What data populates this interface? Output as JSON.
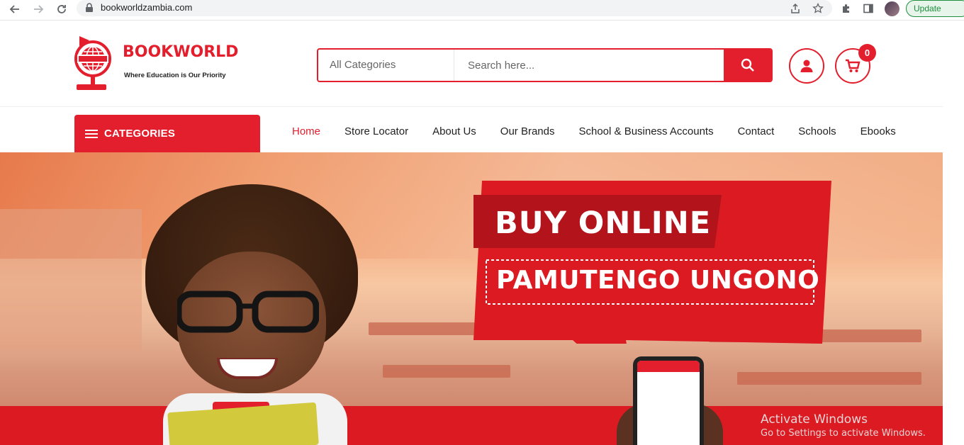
{
  "browser": {
    "url": "bookworldzambia.com",
    "update_label": "Update"
  },
  "header": {
    "brand_name": "BOOKWORLD",
    "tagline": "Where Education is Our Priority",
    "search": {
      "category": "All Categories",
      "placeholder": "Search here..."
    },
    "cart_count": "0"
  },
  "nav": {
    "categories_label": "CATEGORIES",
    "links": [
      "Home",
      "Store Locator",
      "About Us",
      "Our Brands",
      "School & Business Accounts",
      "Contact",
      "Schools",
      "Ebooks"
    ],
    "active": "Home"
  },
  "hero": {
    "headline": "BUY ONLINE",
    "subheadline": "PAMUTENGO UNGONO"
  },
  "watermark": {
    "title": "Activate Windows",
    "subtitle": "Go to Settings to activate Windows."
  },
  "colors": {
    "brand_red": "#e31e2d",
    "update_green": "#1e8e3e"
  }
}
